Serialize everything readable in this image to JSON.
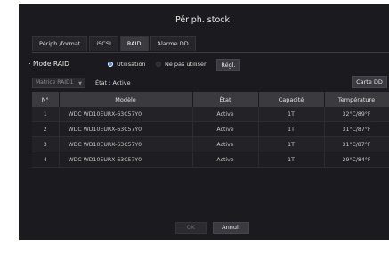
{
  "dialog": {
    "title": "Périph. stock."
  },
  "tabs": [
    {
      "label": "Périph./format",
      "active": false
    },
    {
      "label": "iSCSI",
      "active": false
    },
    {
      "label": "RAID",
      "active": true
    },
    {
      "label": "Alarme DD",
      "active": false
    }
  ],
  "raid": {
    "mode_label": "Mode RAID",
    "option_use": "Utilisation",
    "option_no_use": "Ne pas utiliser",
    "selected_option": "Utilisation",
    "settings_button": "Régl.",
    "card_button": "Carte DD",
    "matrix_select": "Matrice RAID1",
    "status_text": "État : Active"
  },
  "table": {
    "headers": [
      "N°",
      "Modèle",
      "État",
      "Capacité",
      "Température"
    ],
    "rows": [
      {
        "n": "1",
        "model": "WDC WD10EURX-63C57Y0",
        "state": "Active",
        "capacity": "1T",
        "temp": "32°C/89°F"
      },
      {
        "n": "2",
        "model": "WDC WD10EURX-63C57Y0",
        "state": "Active",
        "capacity": "1T",
        "temp": "31°C/87°F"
      },
      {
        "n": "3",
        "model": "WDC WD10EURX-63C57Y0",
        "state": "Active",
        "capacity": "1T",
        "temp": "31°C/87°F"
      },
      {
        "n": "4",
        "model": "WDC WD10EURX-63C57Y0",
        "state": "Active",
        "capacity": "1T",
        "temp": "29°C/84°F"
      }
    ]
  },
  "footer": {
    "ok_label": "OK",
    "ok_enabled": false,
    "cancel_label": "Annul."
  },
  "colors": {
    "background": "#1b1b1f",
    "header_row": "#3a3a3f",
    "radio_accent": "#3c7ad6"
  }
}
